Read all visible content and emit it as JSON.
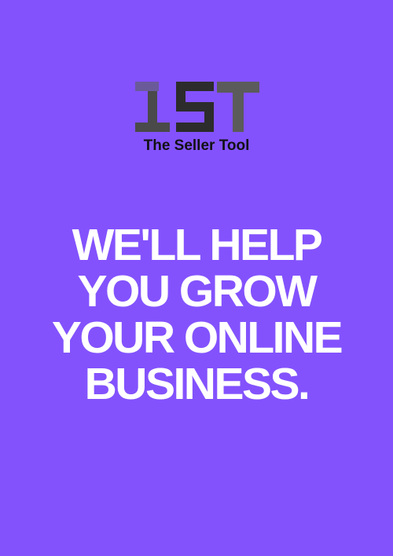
{
  "brand": {
    "name": "The Seller Tool",
    "logo_letters": "TST",
    "logo_colors": {
      "dark": "#2b2b2b",
      "mid": "#5a5a5a",
      "light": "#6c4bb8"
    }
  },
  "headline": {
    "lines": [
      "WE'LL HELP",
      "YOU GROW",
      "YOUR ONLINE",
      "BUSINESS."
    ]
  },
  "colors": {
    "background": "#8352fd",
    "headline": "#ffffff",
    "brand_text": "#111111"
  }
}
